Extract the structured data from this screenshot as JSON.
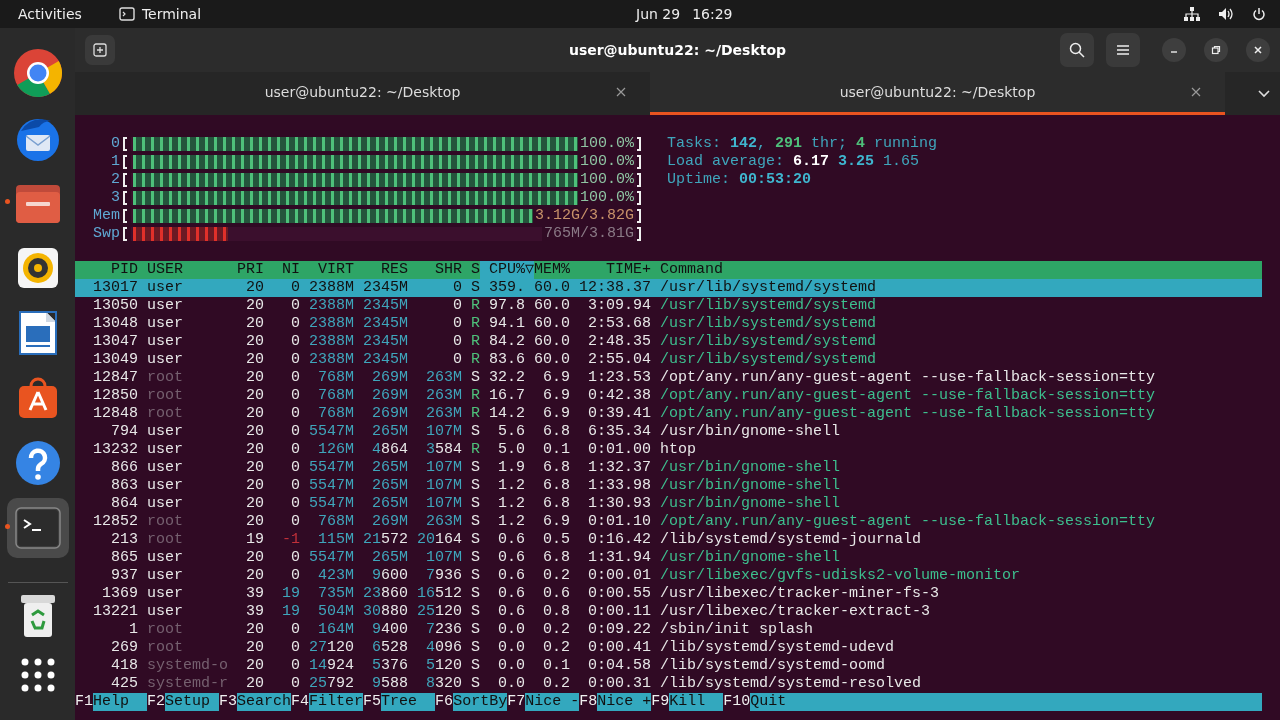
{
  "top_bar": {
    "activities": "Activities",
    "app_name": "Terminal",
    "date": "Jun 29",
    "time": "16:29"
  },
  "dock": [
    {
      "kind": "browser",
      "running": false,
      "focused": false
    },
    {
      "kind": "mail",
      "running": false,
      "focused": false
    },
    {
      "kind": "folder",
      "running": true,
      "focused": false
    },
    {
      "kind": "audio",
      "running": false,
      "focused": false
    },
    {
      "kind": "document",
      "running": false,
      "focused": false
    },
    {
      "kind": "store",
      "running": false,
      "focused": false
    },
    {
      "kind": "help",
      "running": false,
      "focused": false
    },
    {
      "kind": "terminal",
      "running": true,
      "focused": true
    },
    {
      "kind": "trash",
      "running": false,
      "focused": false
    },
    {
      "kind": "grid",
      "running": false,
      "focused": false
    }
  ],
  "window": {
    "title": "user@ubuntu22: ~/Desktop"
  },
  "tabs": [
    {
      "label": "user@ubuntu22: ~/Desktop",
      "selected": false
    },
    {
      "label": "user@ubuntu22: ~/Desktop",
      "selected": true
    }
  ],
  "meters": [
    {
      "label": "0",
      "kind": "cpu",
      "level": 1,
      "value": "100.0%"
    },
    {
      "label": "1",
      "kind": "cpu",
      "level": 1,
      "value": "100.0%"
    },
    {
      "label": "2",
      "kind": "cpu",
      "level": 1,
      "value": "100.0%"
    },
    {
      "label": "3",
      "kind": "cpu",
      "level": 1,
      "value": "100.0%"
    },
    {
      "label": "Mem",
      "kind": "mem",
      "level": 0.8,
      "value": "3.12G/3.82G"
    },
    {
      "label": "Swp",
      "kind": "swap",
      "level": 0.19,
      "value": "765M/3.81G"
    }
  ],
  "summary": [
    {
      "segments": [
        {
          "text": "Tasks: ",
          "kind": "label"
        },
        {
          "text": "142",
          "kind": "value"
        },
        {
          "text": ", ",
          "kind": "label"
        },
        {
          "text": "291",
          "kind": "green"
        },
        {
          "text": " thr; ",
          "kind": "label"
        },
        {
          "text": "4",
          "kind": "green"
        },
        {
          "text": " running",
          "kind": "label"
        }
      ]
    },
    {
      "segments": [
        {
          "text": "Load average: ",
          "kind": "label"
        },
        {
          "text": "6.17",
          "kind": "white"
        },
        {
          "text": " 3.25",
          "kind": "value"
        },
        {
          "text": " 1.65",
          "kind": "label"
        }
      ]
    },
    {
      "segments": [
        {
          "text": "Uptime: ",
          "kind": "label"
        },
        {
          "text": "00:53:20",
          "kind": "value"
        }
      ]
    }
  ],
  "columns": [
    {
      "label": "PID",
      "sorted": false
    },
    {
      "label": "USER",
      "sorted": false
    },
    {
      "label": "PRI",
      "sorted": false
    },
    {
      "label": "NI",
      "sorted": false
    },
    {
      "label": "VIRT",
      "sorted": false
    },
    {
      "label": "RES",
      "sorted": false
    },
    {
      "label": "SHR",
      "sorted": false
    },
    {
      "label": "S",
      "sorted": false
    },
    {
      "label": "CPU%▽",
      "sorted": true
    },
    {
      "label": "MEM%",
      "sorted": false
    },
    {
      "label": "TIME+",
      "sorted": false
    },
    {
      "label": "Command",
      "sorted": false
    }
  ],
  "rows": [
    {
      "selected": true,
      "other_user": false,
      "running": false,
      "thread": false,
      "cells": [
        "13017",
        "user",
        "20",
        "0",
        "2388M",
        "2345M",
        "0",
        "S",
        "359.",
        "60.0",
        "12:38.37",
        "/usr/lib/systemd/systemd"
      ]
    },
    {
      "selected": false,
      "other_user": false,
      "running": true,
      "thread": true,
      "cells": [
        "13050",
        "user",
        "20",
        "0",
        "2388M",
        "2345M",
        "0",
        "R",
        "97.8",
        "60.0",
        "3:09.94",
        "/usr/lib/systemd/systemd"
      ]
    },
    {
      "selected": false,
      "other_user": false,
      "running": true,
      "thread": true,
      "cells": [
        "13048",
        "user",
        "20",
        "0",
        "2388M",
        "2345M",
        "0",
        "R",
        "94.1",
        "60.0",
        "2:53.68",
        "/usr/lib/systemd/systemd"
      ]
    },
    {
      "selected": false,
      "other_user": false,
      "running": true,
      "thread": true,
      "cells": [
        "13047",
        "user",
        "20",
        "0",
        "2388M",
        "2345M",
        "0",
        "R",
        "84.2",
        "60.0",
        "2:48.35",
        "/usr/lib/systemd/systemd"
      ]
    },
    {
      "selected": false,
      "other_user": false,
      "running": true,
      "thread": true,
      "cells": [
        "13049",
        "user",
        "20",
        "0",
        "2388M",
        "2345M",
        "0",
        "R",
        "83.6",
        "60.0",
        "2:55.04",
        "/usr/lib/systemd/systemd"
      ]
    },
    {
      "selected": false,
      "other_user": true,
      "running": false,
      "thread": false,
      "cells": [
        "12847",
        "root",
        "20",
        "0",
        "768M",
        "269M",
        "263M",
        "S",
        "32.2",
        "6.9",
        "1:23.53",
        "/opt/any.run/any-guest-agent --use-fallback-session=tty"
      ]
    },
    {
      "selected": false,
      "other_user": true,
      "running": true,
      "thread": true,
      "cells": [
        "12850",
        "root",
        "20",
        "0",
        "768M",
        "269M",
        "263M",
        "R",
        "16.7",
        "6.9",
        "0:42.38",
        "/opt/any.run/any-guest-agent --use-fallback-session=tty"
      ]
    },
    {
      "selected": false,
      "other_user": true,
      "running": true,
      "thread": true,
      "cells": [
        "12848",
        "root",
        "20",
        "0",
        "768M",
        "269M",
        "263M",
        "R",
        "14.2",
        "6.9",
        "0:39.41",
        "/opt/any.run/any-guest-agent --use-fallback-session=tty"
      ]
    },
    {
      "selected": false,
      "other_user": false,
      "running": false,
      "thread": false,
      "cells": [
        "794",
        "user",
        "20",
        "0",
        "5547M",
        "265M",
        "107M",
        "S",
        "5.6",
        "6.8",
        "6:35.34",
        "/usr/bin/gnome-shell"
      ]
    },
    {
      "selected": false,
      "other_user": false,
      "running": true,
      "thread": false,
      "cells": [
        "13232",
        "user",
        "20",
        "0",
        "126M",
        "4864",
        "3584",
        "R",
        "5.0",
        "0.1",
        "0:01.00",
        "htop"
      ]
    },
    {
      "selected": false,
      "other_user": false,
      "running": false,
      "thread": true,
      "cells": [
        "866",
        "user",
        "20",
        "0",
        "5547M",
        "265M",
        "107M",
        "S",
        "1.9",
        "6.8",
        "1:32.37",
        "/usr/bin/gnome-shell"
      ]
    },
    {
      "selected": false,
      "other_user": false,
      "running": false,
      "thread": true,
      "cells": [
        "863",
        "user",
        "20",
        "0",
        "5547M",
        "265M",
        "107M",
        "S",
        "1.2",
        "6.8",
        "1:33.98",
        "/usr/bin/gnome-shell"
      ]
    },
    {
      "selected": false,
      "other_user": false,
      "running": false,
      "thread": true,
      "cells": [
        "864",
        "user",
        "20",
        "0",
        "5547M",
        "265M",
        "107M",
        "S",
        "1.2",
        "6.8",
        "1:30.93",
        "/usr/bin/gnome-shell"
      ]
    },
    {
      "selected": false,
      "other_user": true,
      "running": false,
      "thread": true,
      "cells": [
        "12852",
        "root",
        "20",
        "0",
        "768M",
        "269M",
        "263M",
        "S",
        "1.2",
        "6.9",
        "0:01.10",
        "/opt/any.run/any-guest-agent --use-fallback-session=tty"
      ]
    },
    {
      "selected": false,
      "other_user": true,
      "running": false,
      "thread": false,
      "cells": [
        "213",
        "root",
        "19",
        "-1",
        "115M",
        "21572",
        "20164",
        "S",
        "0.6",
        "0.5",
        "0:16.42",
        "/lib/systemd/systemd-journald"
      ]
    },
    {
      "selected": false,
      "other_user": false,
      "running": false,
      "thread": true,
      "cells": [
        "865",
        "user",
        "20",
        "0",
        "5547M",
        "265M",
        "107M",
        "S",
        "0.6",
        "6.8",
        "1:31.94",
        "/usr/bin/gnome-shell"
      ]
    },
    {
      "selected": false,
      "other_user": false,
      "running": false,
      "thread": true,
      "cells": [
        "937",
        "user",
        "20",
        "0",
        "423M",
        "9600",
        "7936",
        "S",
        "0.6",
        "0.2",
        "0:00.01",
        "/usr/libexec/gvfs-udisks2-volume-monitor"
      ]
    },
    {
      "selected": false,
      "other_user": false,
      "running": false,
      "thread": false,
      "cells": [
        "1369",
        "user",
        "39",
        "19",
        "735M",
        "23860",
        "16512",
        "S",
        "0.6",
        "0.6",
        "0:00.55",
        "/usr/libexec/tracker-miner-fs-3"
      ]
    },
    {
      "selected": false,
      "other_user": false,
      "running": false,
      "thread": false,
      "cells": [
        "13221",
        "user",
        "39",
        "19",
        "504M",
        "30880",
        "25120",
        "S",
        "0.6",
        "0.8",
        "0:00.11",
        "/usr/libexec/tracker-extract-3"
      ]
    },
    {
      "selected": false,
      "other_user": true,
      "running": false,
      "thread": false,
      "cells": [
        "1",
        "root",
        "20",
        "0",
        "164M",
        "9400",
        "7236",
        "S",
        "0.0",
        "0.2",
        "0:09.22",
        "/sbin/init splash"
      ]
    },
    {
      "selected": false,
      "other_user": true,
      "running": false,
      "thread": false,
      "cells": [
        "269",
        "root",
        "20",
        "0",
        "27120",
        "6528",
        "4096",
        "S",
        "0.0",
        "0.2",
        "0:00.41",
        "/lib/systemd/systemd-udevd"
      ]
    },
    {
      "selected": false,
      "other_user": true,
      "running": false,
      "thread": false,
      "cells": [
        "418",
        "systemd-o",
        "20",
        "0",
        "14924",
        "5376",
        "5120",
        "S",
        "0.0",
        "0.1",
        "0:04.58",
        "/lib/systemd/systemd-oomd"
      ]
    },
    {
      "selected": false,
      "other_user": true,
      "running": false,
      "thread": false,
      "cells": [
        "425",
        "systemd-r",
        "20",
        "0",
        "25792",
        "9588",
        "8320",
        "S",
        "0.0",
        "0.2",
        "0:00.31",
        "/lib/systemd/systemd-resolved"
      ]
    }
  ],
  "function_keys": [
    {
      "key": "F1",
      "label": "Help"
    },
    {
      "key": "F2",
      "label": "Setup"
    },
    {
      "key": "F3",
      "label": "Search"
    },
    {
      "key": "F4",
      "label": "Filter"
    },
    {
      "key": "F5",
      "label": "Tree"
    },
    {
      "key": "F6",
      "label": "SortBy"
    },
    {
      "key": "F7",
      "label": "Nice -"
    },
    {
      "key": "F8",
      "label": "Nice +"
    },
    {
      "key": "F9",
      "label": "Kill"
    },
    {
      "key": "F10",
      "label": "Quit"
    }
  ]
}
